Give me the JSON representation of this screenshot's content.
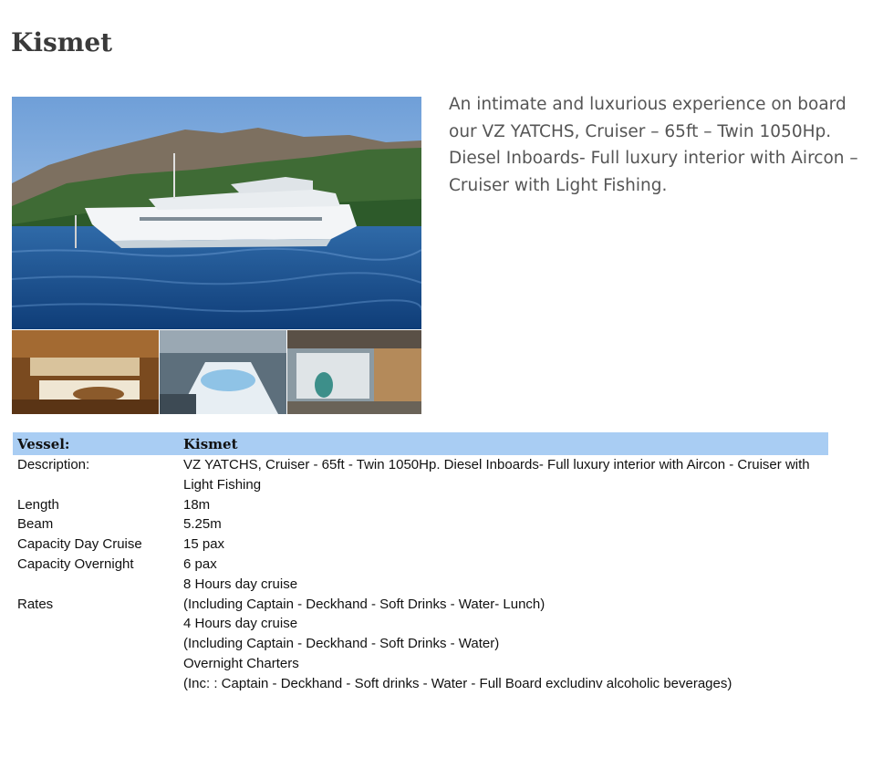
{
  "page": {
    "title": "Kismet",
    "intro": "An intimate and luxurious experience on board our VZ YATCHS, Cruiser – 65ft – Twin 1050Hp. Diesel Inboards- Full luxury interior with Aircon – Cruiser with Light Fishing."
  },
  "gallery": {
    "main_photo": "yacht-photo",
    "thumbnails": [
      "salon-interior-photo",
      "jacuzzi-deck-photo",
      "aft-deck-photo"
    ]
  },
  "specs": {
    "header": {
      "label": "Vessel:",
      "value": "Kismet"
    },
    "rows": [
      {
        "label": "Description:",
        "lines": [
          "VZ YATCHS, Cruiser - 65ft - Twin 1050Hp. Diesel Inboards- Full luxury interior with Aircon - Cruiser with Light Fishing"
        ]
      },
      {
        "label": "Length",
        "lines": [
          "18m"
        ]
      },
      {
        "label": "Beam",
        "lines": [
          "5.25m"
        ]
      },
      {
        "label": "Capacity Day Cruise",
        "lines": [
          "15 pax"
        ]
      },
      {
        "label": "Capacity Overnight",
        "lines": [
          "6 pax"
        ]
      },
      {
        "label": "",
        "lines": [
          "8 Hours day cruise"
        ]
      },
      {
        "label": "Rates",
        "lines": [
          "(Including Captain - Deckhand - Soft Drinks - Water- Lunch)",
          "4 Hours day cruise",
          "(Including Captain - Deckhand - Soft Drinks - Water)",
          "Overnight Charters",
          "(Inc: : Captain - Deckhand - Soft drinks - Water - Full Board excludinv alcoholic beverages)"
        ]
      }
    ]
  },
  "colors": {
    "header_row_bg": "#a9cdf3",
    "intro_text": "#555555",
    "title_text": "#3a3a3a"
  }
}
